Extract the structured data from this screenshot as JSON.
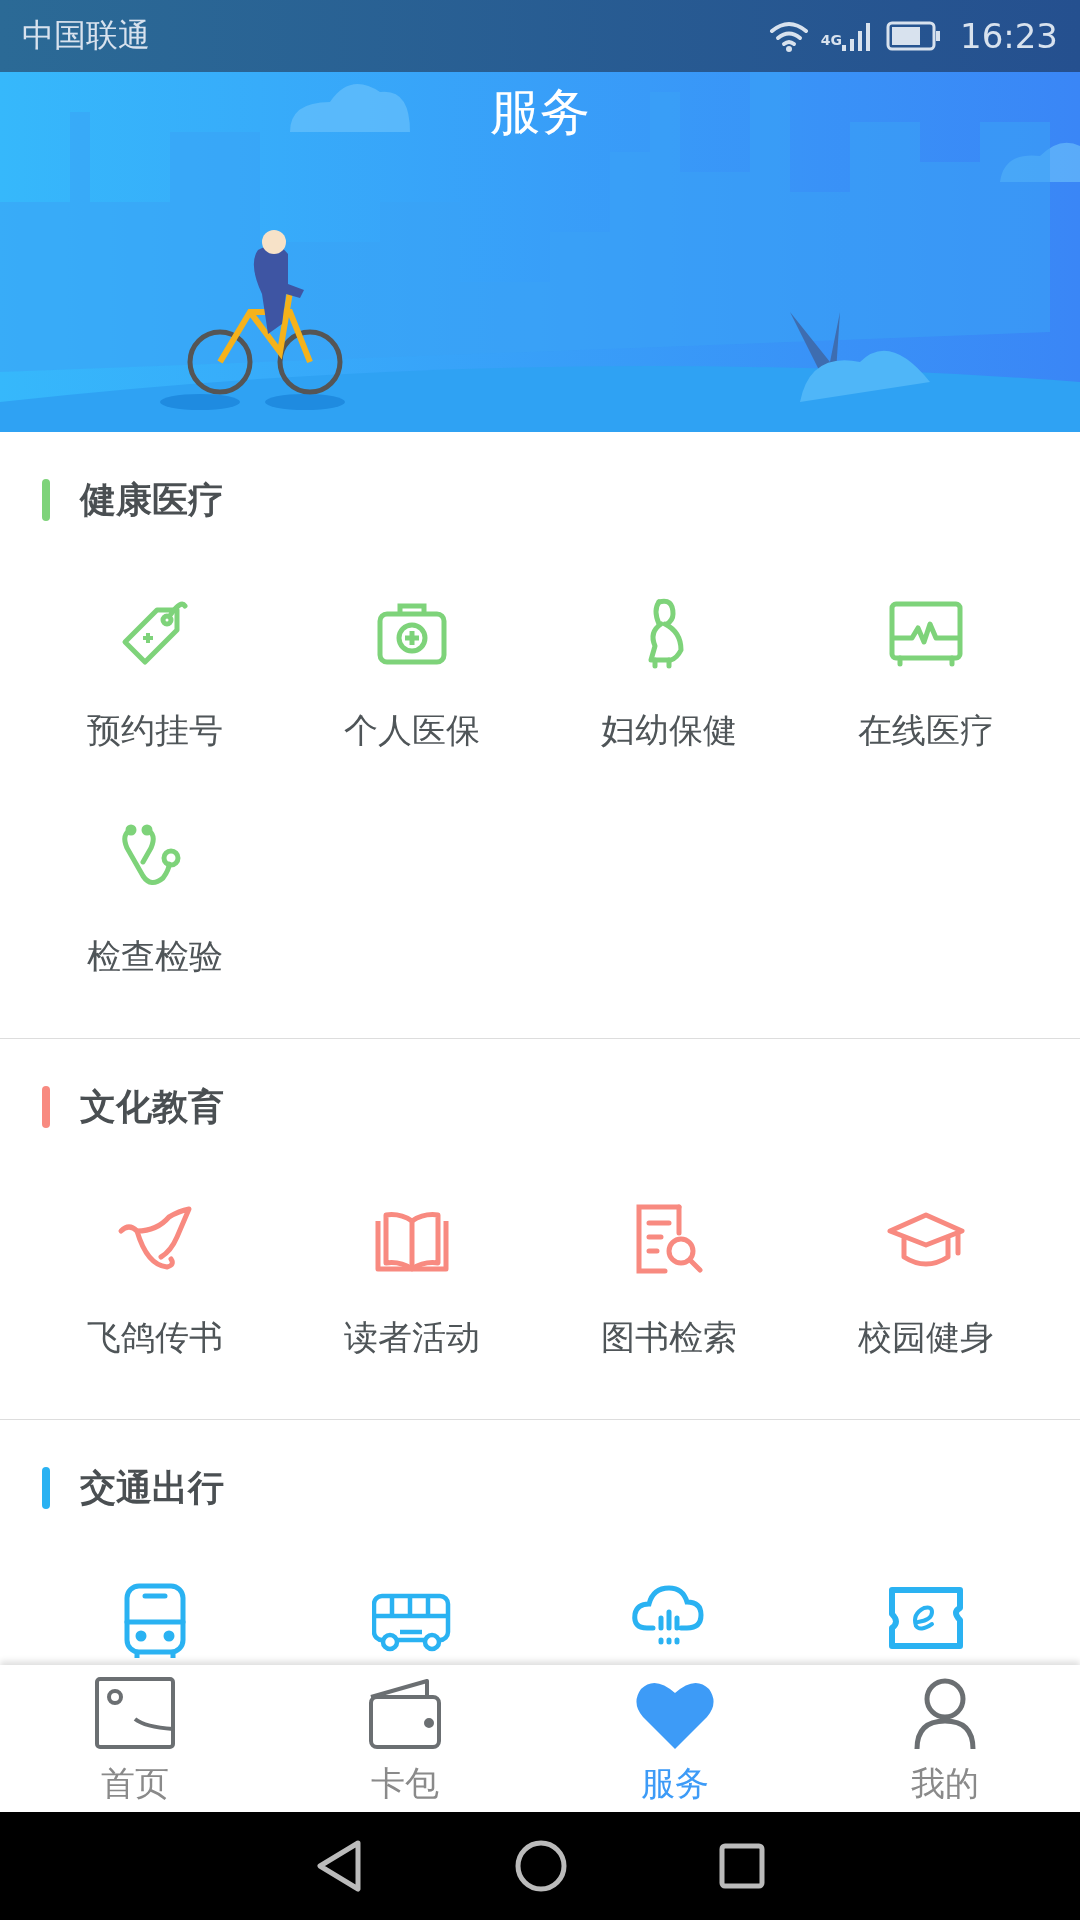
{
  "status_bar": {
    "carrier": "中国联通",
    "network": "4G",
    "time": "16:23"
  },
  "header": {
    "title": "服务"
  },
  "sections": [
    {
      "title": "健康医疗",
      "color": "#7ed37a",
      "items": [
        {
          "kind": "service",
          "label": "预约挂号"
        },
        {
          "kind": "service",
          "label": "个人医保"
        },
        {
          "kind": "service",
          "label": "妇幼保健"
        },
        {
          "kind": "service",
          "label": "在线医疗"
        },
        {
          "kind": "service",
          "label": "检查检验"
        }
      ]
    },
    {
      "title": "文化教育",
      "color": "#f88a80",
      "items": [
        {
          "kind": "service",
          "label": "飞鸽传书"
        },
        {
          "kind": "service",
          "label": "读者活动"
        },
        {
          "kind": "service",
          "label": "图书检索"
        },
        {
          "kind": "service",
          "label": "校园健身"
        }
      ]
    },
    {
      "title": "交通出行",
      "color": "#2ab2f2",
      "items": [
        {
          "kind": "service"
        },
        {
          "kind": "service"
        },
        {
          "kind": "service"
        },
        {
          "kind": "service"
        }
      ]
    }
  ],
  "tabs": [
    {
      "label": "首页",
      "selected": false
    },
    {
      "label": "卡包",
      "selected": false
    },
    {
      "label": "服务",
      "selected": true
    },
    {
      "label": "我的",
      "selected": false
    }
  ]
}
